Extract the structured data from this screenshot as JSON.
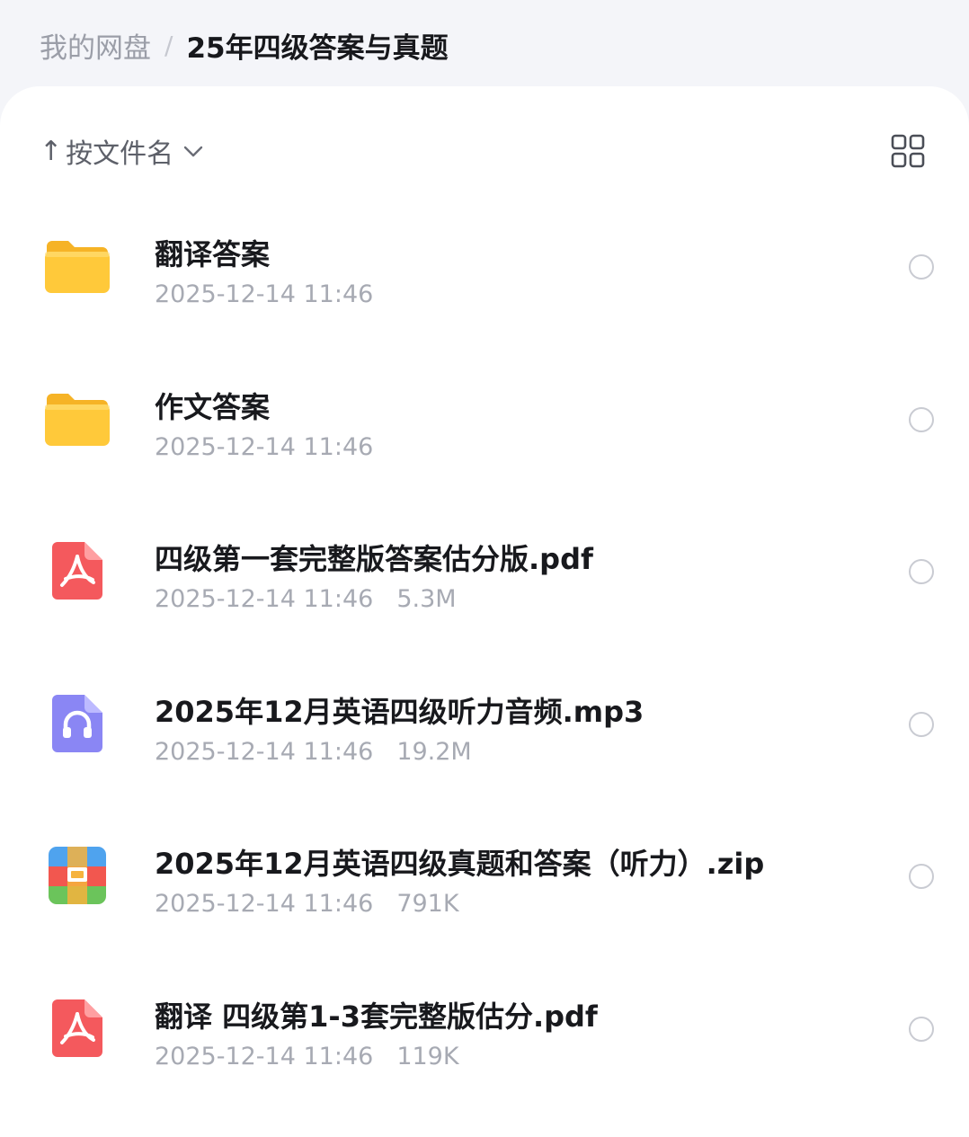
{
  "breadcrumb": {
    "root": "我的网盘",
    "separator": "/",
    "current": "25年四级答案与真题"
  },
  "toolbar": {
    "sort_arrow": "↑",
    "sort_label": "按文件名",
    "view_toggle_icon": "grid-view-icon"
  },
  "files": [
    {
      "name": "翻译答案",
      "date": "2025-12-14 11:46",
      "size": "",
      "type": "folder",
      "icon": "folder-icon"
    },
    {
      "name": "作文答案",
      "date": "2025-12-14 11:46",
      "size": "",
      "type": "folder",
      "icon": "folder-icon"
    },
    {
      "name": "四级第一套完整版答案估分版.pdf",
      "date": "2025-12-14 11:46",
      "size": "5.3M",
      "type": "pdf",
      "icon": "pdf-icon"
    },
    {
      "name": "2025年12月英语四级听力音频.mp3",
      "date": "2025-12-14 11:46",
      "size": "19.2M",
      "type": "audio",
      "icon": "audio-icon"
    },
    {
      "name": "2025年12月英语四级真题和答案（听力）.zip",
      "date": "2025-12-14 11:46",
      "size": "791K",
      "type": "zip",
      "icon": "zip-icon"
    },
    {
      "name": "翻译 四级第1-3套完整版估分.pdf",
      "date": "2025-12-14 11:46",
      "size": "119K",
      "type": "pdf",
      "icon": "pdf-icon"
    }
  ],
  "colors": {
    "folder": "#ffc93a",
    "pdf": "#f4595d",
    "audio": "#8a86f4",
    "zip_red": "#f2574f",
    "zip_orange": "#f6b33d",
    "zip_green": "#6bc45b",
    "zip_blue": "#4fa3ee"
  }
}
